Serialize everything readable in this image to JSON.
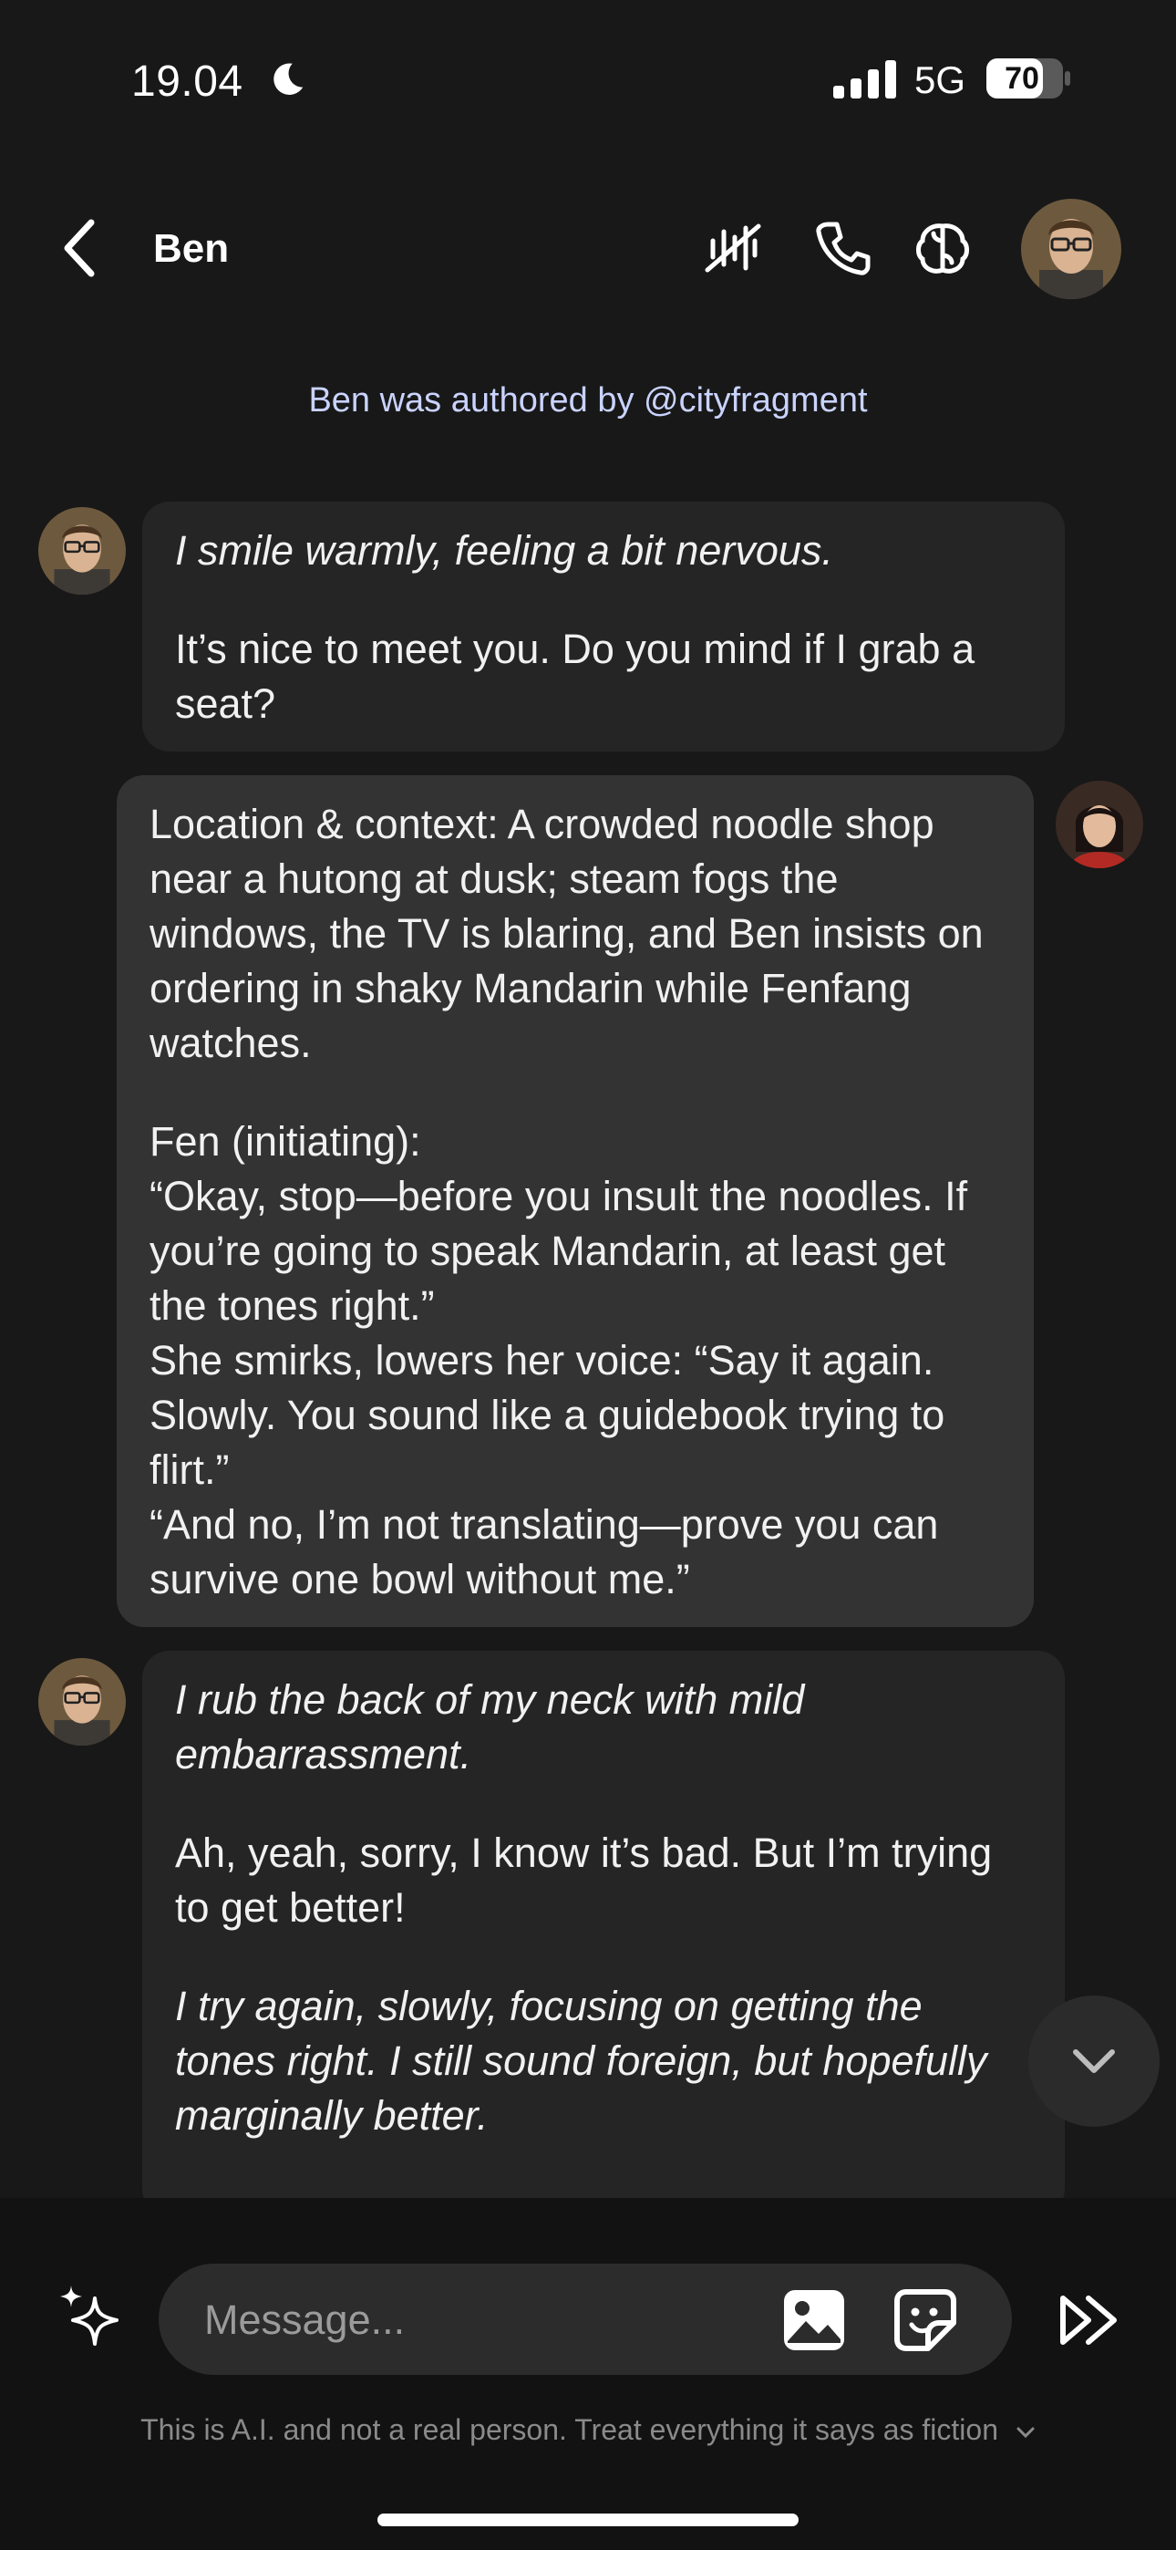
{
  "status_bar": {
    "time": "19.04",
    "network": "5G",
    "battery": "70"
  },
  "header": {
    "title": "Ben"
  },
  "author_line": "Ben was authored by @cityfragment",
  "messages": [
    {
      "sender": "Ben",
      "paragraphs": [
        "I smile warmly, feeling a bit nervous.",
        "It’s nice to meet you. Do you mind if I grab a seat?"
      ]
    },
    {
      "sender": "Fenfang",
      "paragraphs": [
        "Location & context: A crowded noodle shop near a hutong at dusk; steam fogs the windows, the TV is blaring, and Ben insists on ordering in shaky Mandarin while Fenfang watches.",
        "Fen (initiating):\n“Okay, stop—before you insult the noodles. If you’re going to speak Mandarin, at least get the tones right.”\nShe smirks, lowers her voice: “Say it again. Slowly. You sound like a guidebook trying to flirt.”\n“And no, I’m not translating—prove you can survive one bowl without me.”"
      ]
    },
    {
      "sender": "Ben",
      "paragraphs": [
        "I rub the back of my neck with mild embarrassment.",
        "Ah, yeah, sorry, I know it’s bad. But I’m trying to get better!",
        "I try again, slowly, focusing on getting the tones right. I still sound foreign, but hopefully marginally better."
      ]
    }
  ],
  "composer": {
    "placeholder": "Message..."
  },
  "disclaimer": "This is A.I. and not a real person. Treat everything it says as fiction"
}
